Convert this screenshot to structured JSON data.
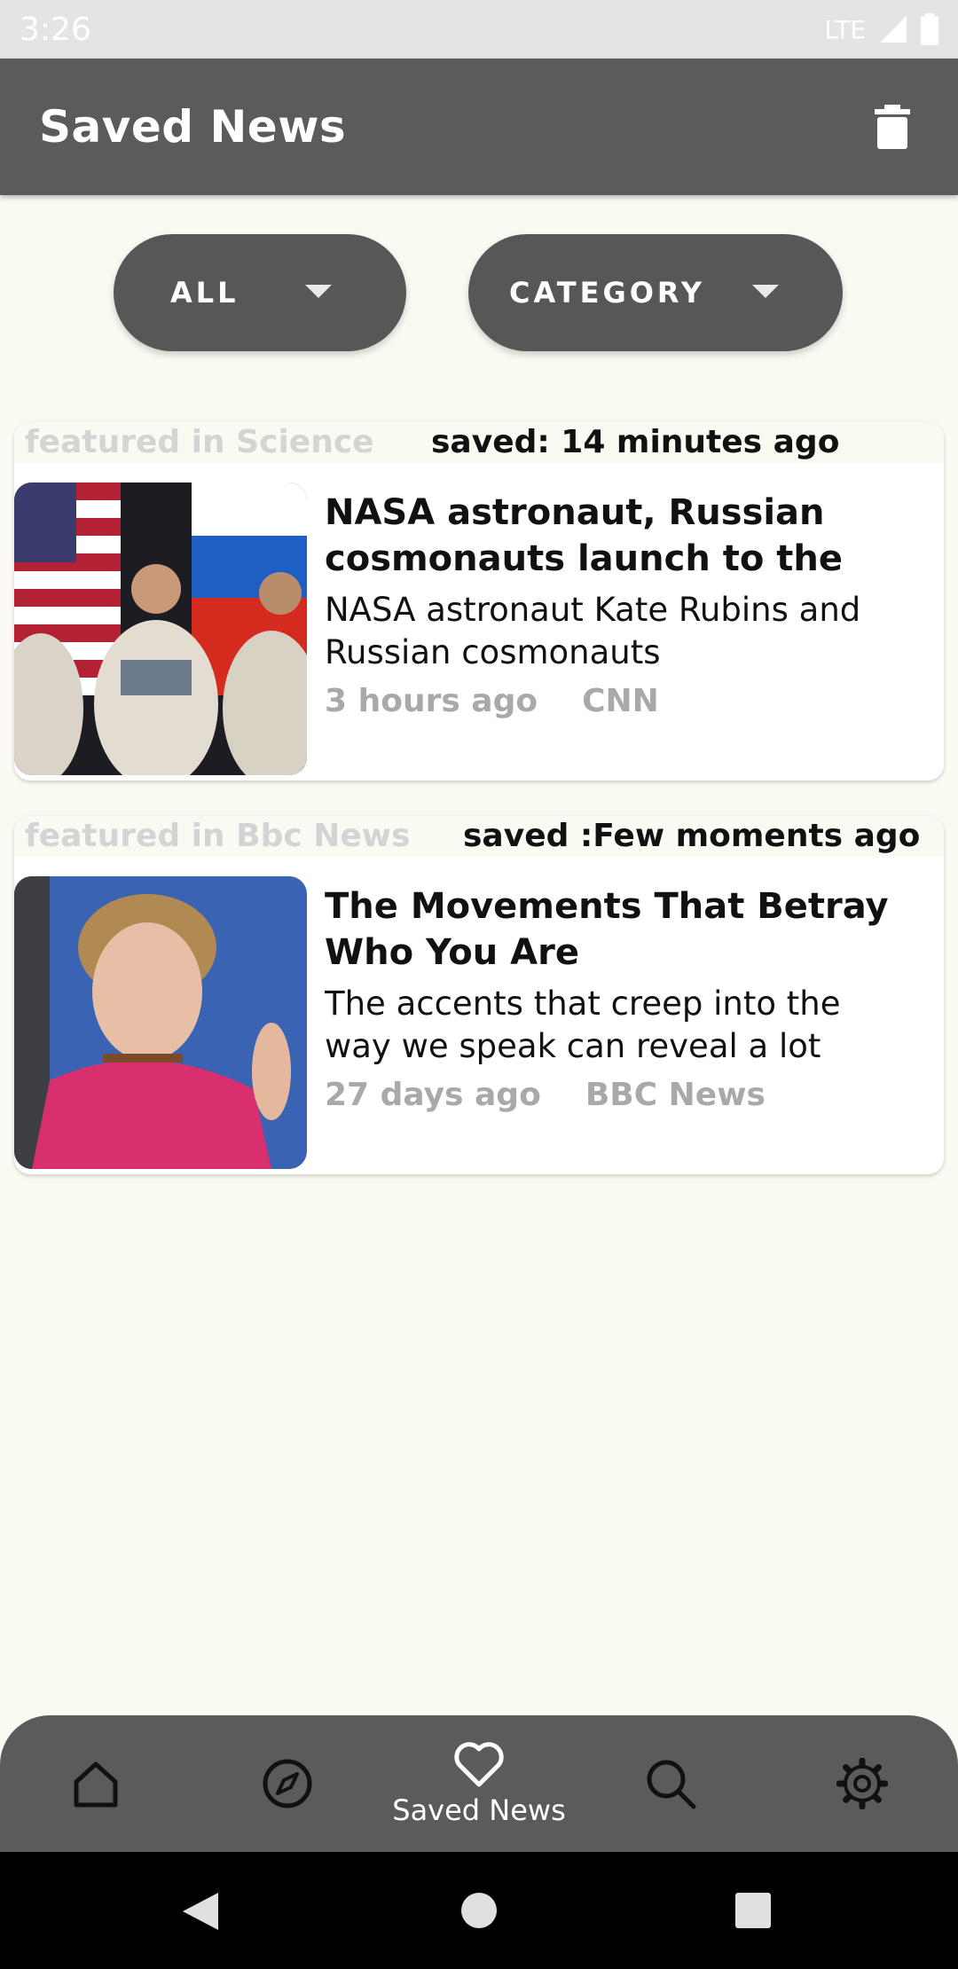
{
  "status_bar": {
    "time": "3:26",
    "network": "LTE"
  },
  "app_bar": {
    "title": "Saved News",
    "delete_icon": "trash-icon"
  },
  "filters": {
    "all_label": "ALL",
    "category_label": "CATEGORY"
  },
  "articles": [
    {
      "featured": "featured in Science",
      "saved": "saved: 14 minutes ago",
      "headline": "NASA astronaut, Russian cosmonauts launch to the",
      "summary": "NASA astronaut Kate Rubins and Russian cosmonauts",
      "time": "3 hours ago",
      "source": "CNN"
    },
    {
      "featured": "featured in Bbc News",
      "saved": "saved :Few moments ago",
      "headline": "The Movements That Betray Who You Are",
      "summary": "The accents that creep into the way we speak can reveal a lot",
      "time": "27 days ago",
      "source": "BBC News"
    }
  ],
  "bottom_nav": {
    "items": [
      {
        "icon": "home-icon"
      },
      {
        "icon": "compass-icon"
      },
      {
        "icon": "heart-icon",
        "label": "Saved News",
        "active": true
      },
      {
        "icon": "search-icon"
      },
      {
        "icon": "gear-icon"
      }
    ]
  },
  "colors": {
    "app_bar": "#5b5b5b",
    "background": "#fafaf3",
    "muted_text": "#a9a9a9"
  }
}
